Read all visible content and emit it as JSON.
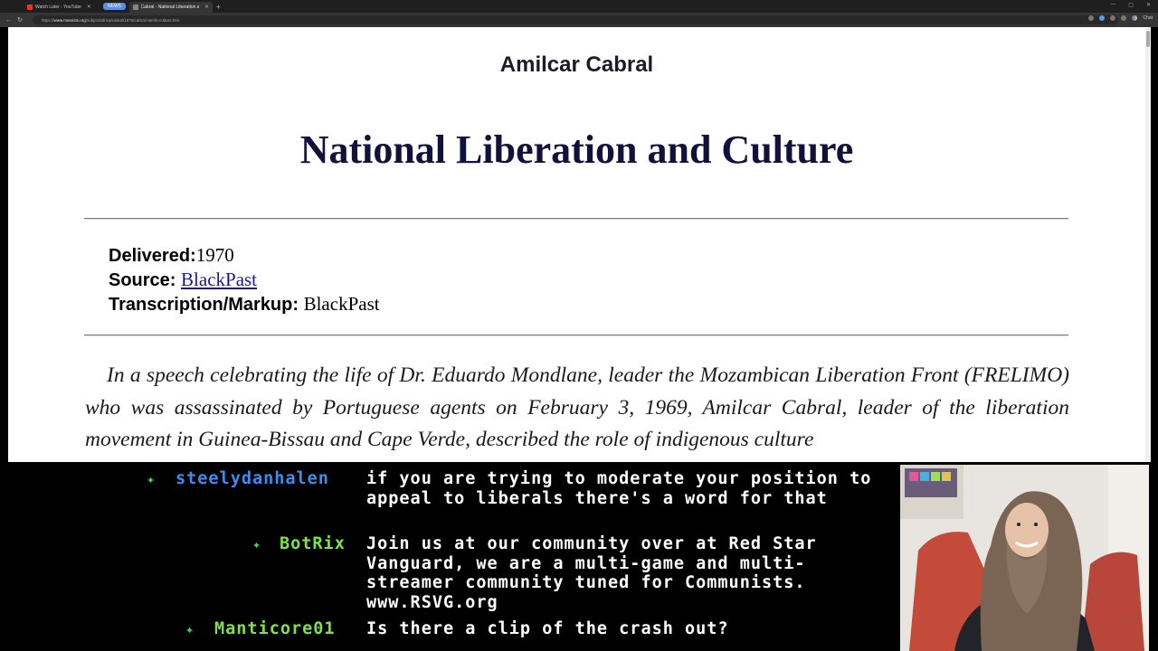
{
  "browser": {
    "tabs": [
      {
        "label": "Watch Later - YouTube",
        "color": "#ff2b2b"
      },
      {
        "label": "Cabral - National Liberation and Culture",
        "color": "#888888"
      }
    ],
    "tab_group_label": "NEWS",
    "url_prefix": "https://",
    "url_host": "www.marxists.org",
    "url_path": "/subject/africa/cabral/1970/cabral-nat-lib-culture.htm",
    "chat_label": "Chat"
  },
  "page": {
    "author": "Amilcar Cabral",
    "title": "National Liberation and Culture",
    "delivered_label": "Delivered:",
    "delivered_value": "1970",
    "source_label": "Source: ",
    "source_value": "BlackPast",
    "transcription_label": "Transcription/Markup: ",
    "transcription_value": "BlackPast",
    "intro": "In a speech celebrating the life of Dr. Eduardo Mondlane, leader the Mozambican Liberation Front (FRELIMO) who was assassinated by Portuguese agents on February 3, 1969, Amilcar Cabral, leader of the liberation movement in Guinea-Bissau and Cape Verde, described the role of indigenous culture"
  },
  "chat": {
    "badge_glyph": "✦",
    "messages": [
      {
        "user": "steelydanhalen",
        "user_color": "#3b8df0",
        "text": "if you are trying to moderate your position to appeal to liberals there's a word for that"
      },
      {
        "user": "BotRix",
        "user_color": "#7fe24a",
        "text": "Join us at our community over at Red Star Vanguard, we are a multi-game and multi-streamer community tuned for Communists. www.RSVG.org"
      },
      {
        "user": "Manticore01",
        "user_color": "#7fe24a",
        "text": "Is there a clip of the crash out?"
      }
    ]
  }
}
